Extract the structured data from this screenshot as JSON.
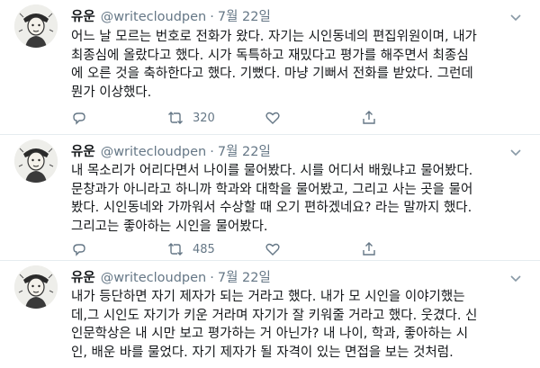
{
  "tweets": [
    {
      "name": "유운",
      "handle": "@writecloudpen",
      "separator": "·",
      "date": "7월 22일",
      "lines": [
        "어느 날 모르는 번호로 전화가 왔다. 자기는 시인동네의 편집위원이며, 내가",
        "최종심에 올랐다고 했다. 시가 독특하고 재밌다고 평가를 해주면서 최종심",
        "에 오른 것을 축하한다고 했다. 기뻤다. 마냥 기뻐서 전화를 받았다. 그런데",
        "뭔가 이상했다."
      ],
      "retweets": "320",
      "show_actions": true
    },
    {
      "name": "유운",
      "handle": "@writecloudpen",
      "separator": "·",
      "date": "7월 22일",
      "lines": [
        "내 목소리가 어리다면서 나이를 물어봤다. 시를 어디서 배웠냐고 물어봤다.",
        "문창과가 아니라고 하니까 학과와 대학을 물어봤고, 그리고 사는 곳을 물어",
        "봤다. 시인동네와 가까워서 수상할 때 오기 편하겠네요? 라는 말까지 했다.",
        "그리고는 좋아하는 시인을 물어봤다."
      ],
      "retweets": "485",
      "show_actions": true
    },
    {
      "name": "유운",
      "handle": "@writecloudpen",
      "separator": "·",
      "date": "7월 22일",
      "lines": [
        "내가 등단하면 자기 제자가 되는 거라고 했다. 내가 모 시인을 이야기했는",
        "데,그 시인도 자기가 키운 거라며 자기가 잘 키워줄 거라고 했다. 웃겼다. 신",
        "인문학상은 내 시만 보고 평가하는 거 아닌가? 내 나이, 학과, 좋아하는 시",
        "인, 배운 바를 물었다. 자기 제자가 될 자격이 있는 면접을 보는 것처럼."
      ],
      "retweets": "",
      "show_actions": false
    }
  ]
}
